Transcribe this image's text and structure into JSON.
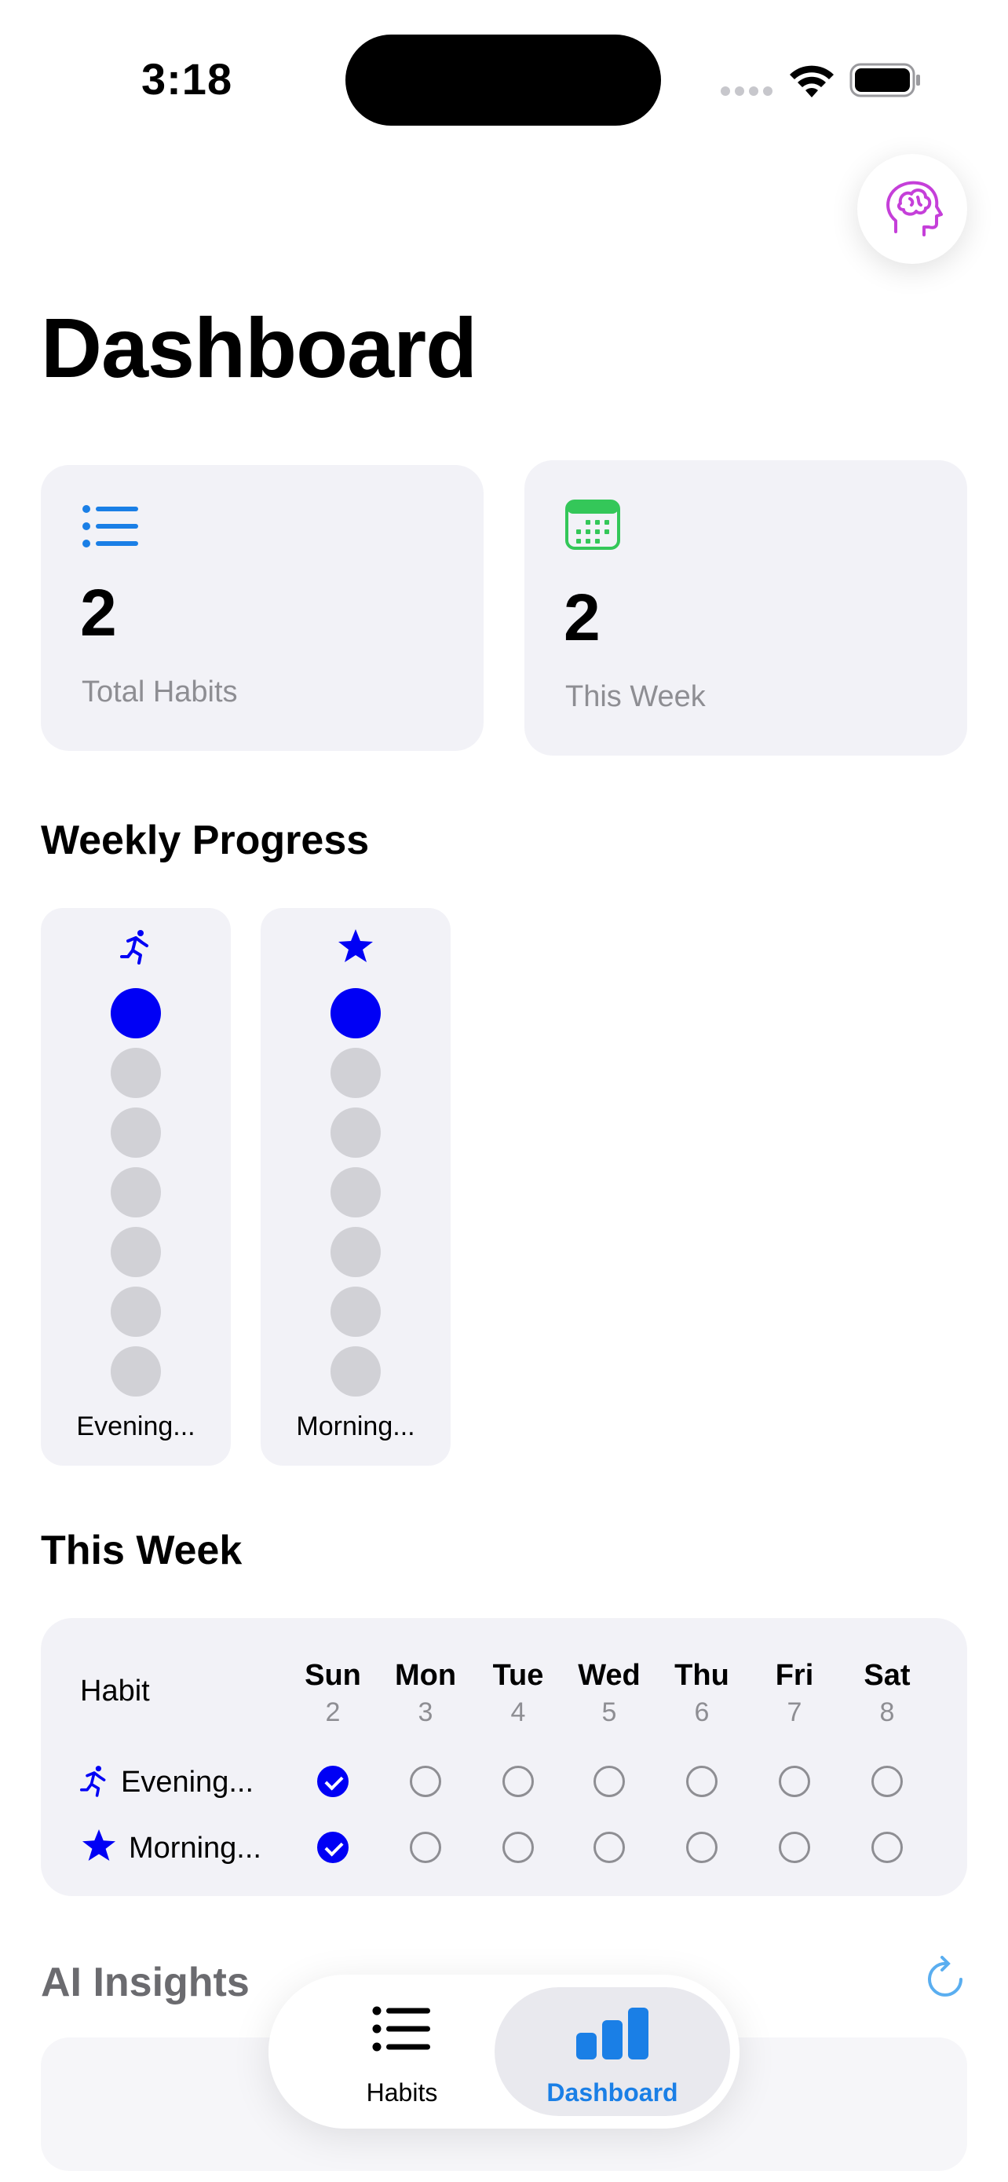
{
  "status_bar": {
    "time": "3:18"
  },
  "header": {
    "title": "Dashboard",
    "ai_button_icon": "brain-head-icon"
  },
  "stats": [
    {
      "icon": "list-icon",
      "value": "2",
      "label": "Total Habits",
      "color": "#1a7fe6"
    },
    {
      "icon": "calendar-icon",
      "value": "2",
      "label": "This Week",
      "color": "#34c759"
    }
  ],
  "weekly_progress": {
    "title": "Weekly Progress",
    "habits": [
      {
        "name": "Evening...",
        "icon": "running-figure-icon",
        "completed_days": 1,
        "total_days": 7
      },
      {
        "name": "Morning...",
        "icon": "star-icon",
        "completed_days": 1,
        "total_days": 7
      }
    ]
  },
  "this_week": {
    "title": "This Week",
    "habit_header": "Habit",
    "days": [
      {
        "name": "Sun",
        "date": "2"
      },
      {
        "name": "Mon",
        "date": "3"
      },
      {
        "name": "Tue",
        "date": "4"
      },
      {
        "name": "Wed",
        "date": "5"
      },
      {
        "name": "Thu",
        "date": "6"
      },
      {
        "name": "Fri",
        "date": "7"
      },
      {
        "name": "Sat",
        "date": "8"
      }
    ],
    "rows": [
      {
        "name": "Evening...",
        "icon": "running-figure-icon",
        "done": [
          true,
          false,
          false,
          false,
          false,
          false,
          false
        ]
      },
      {
        "name": "Morning...",
        "icon": "star-icon",
        "done": [
          true,
          false,
          false,
          false,
          false,
          false,
          false
        ]
      }
    ]
  },
  "ai_insights": {
    "title": "AI Insights",
    "refresh_icon": "refresh-icon"
  },
  "tabbar": {
    "tabs": [
      {
        "label": "Habits",
        "icon": "list-icon",
        "selected": false
      },
      {
        "label": "Dashboard",
        "icon": "bar-chart-icon",
        "selected": true
      }
    ]
  },
  "colors": {
    "accent": "#1a7fe6",
    "completed": "#0000f5",
    "card_bg": "#f2f2f7",
    "brain": "#c53fd9"
  }
}
